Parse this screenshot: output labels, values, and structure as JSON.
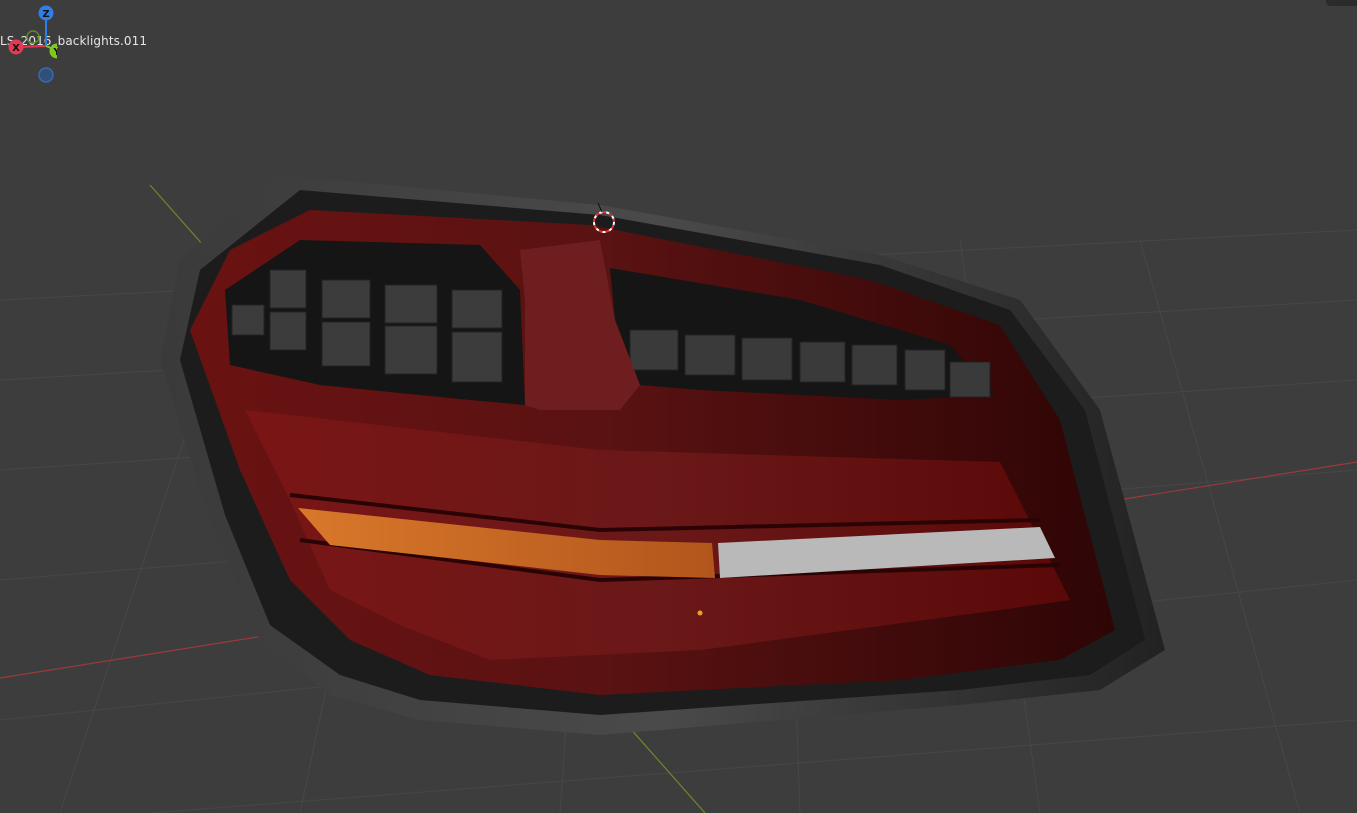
{
  "viewport": {
    "object_name": "LS_2016_backlights.011"
  },
  "gizmo": {
    "axes": [
      {
        "name": "z-axis",
        "label": "Z",
        "color": "#2f7fe6"
      },
      {
        "name": "x-axis",
        "label": "X",
        "color": "#e23a52"
      },
      {
        "name": "y-axis",
        "label": "Y",
        "color": "#7ecb20"
      }
    ]
  },
  "colors": {
    "viewport_bg": "#3d3d3d",
    "grid_line": "#474747",
    "x_axis_line": "#9a3a3a",
    "y_axis_line": "#6a8a2a",
    "housing": "#2a2a2a",
    "lens_red": "#6e1414",
    "amber_strip": "#c8651f",
    "white_strip": "#b8b8b8"
  }
}
